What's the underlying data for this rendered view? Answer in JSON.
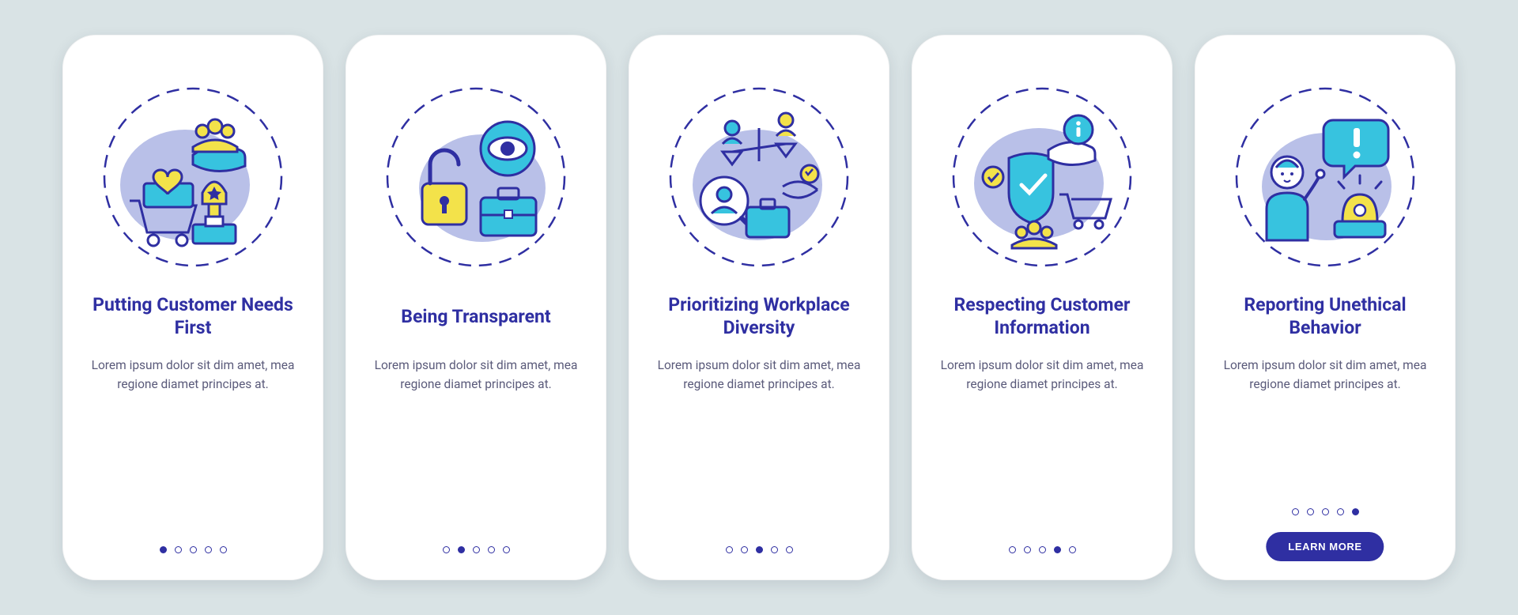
{
  "colors": {
    "indigo": "#2f2fa2",
    "cyan": "#37c3df",
    "yellow": "#f3e24a",
    "pale": "#b9c0e8"
  },
  "total_steps": 5,
  "desc": "Lorem ipsum dolor sit dim amet, mea regione diamet principes at.",
  "cta_label": "LEARN MORE",
  "cards": [
    {
      "title": "Putting Customer Needs First",
      "icon": "customer-first-icon",
      "active_index": 0,
      "has_cta": false
    },
    {
      "title": "Being Transparent",
      "icon": "transparent-icon",
      "active_index": 1,
      "has_cta": false
    },
    {
      "title": "Prioritizing Workplace Diversity",
      "icon": "diversity-icon",
      "active_index": 2,
      "has_cta": false
    },
    {
      "title": "Respecting Customer Information",
      "icon": "customer-info-icon",
      "active_index": 3,
      "has_cta": false
    },
    {
      "title": "Reporting Unethical Behavior",
      "icon": "report-unethical-icon",
      "active_index": 4,
      "has_cta": true
    }
  ]
}
